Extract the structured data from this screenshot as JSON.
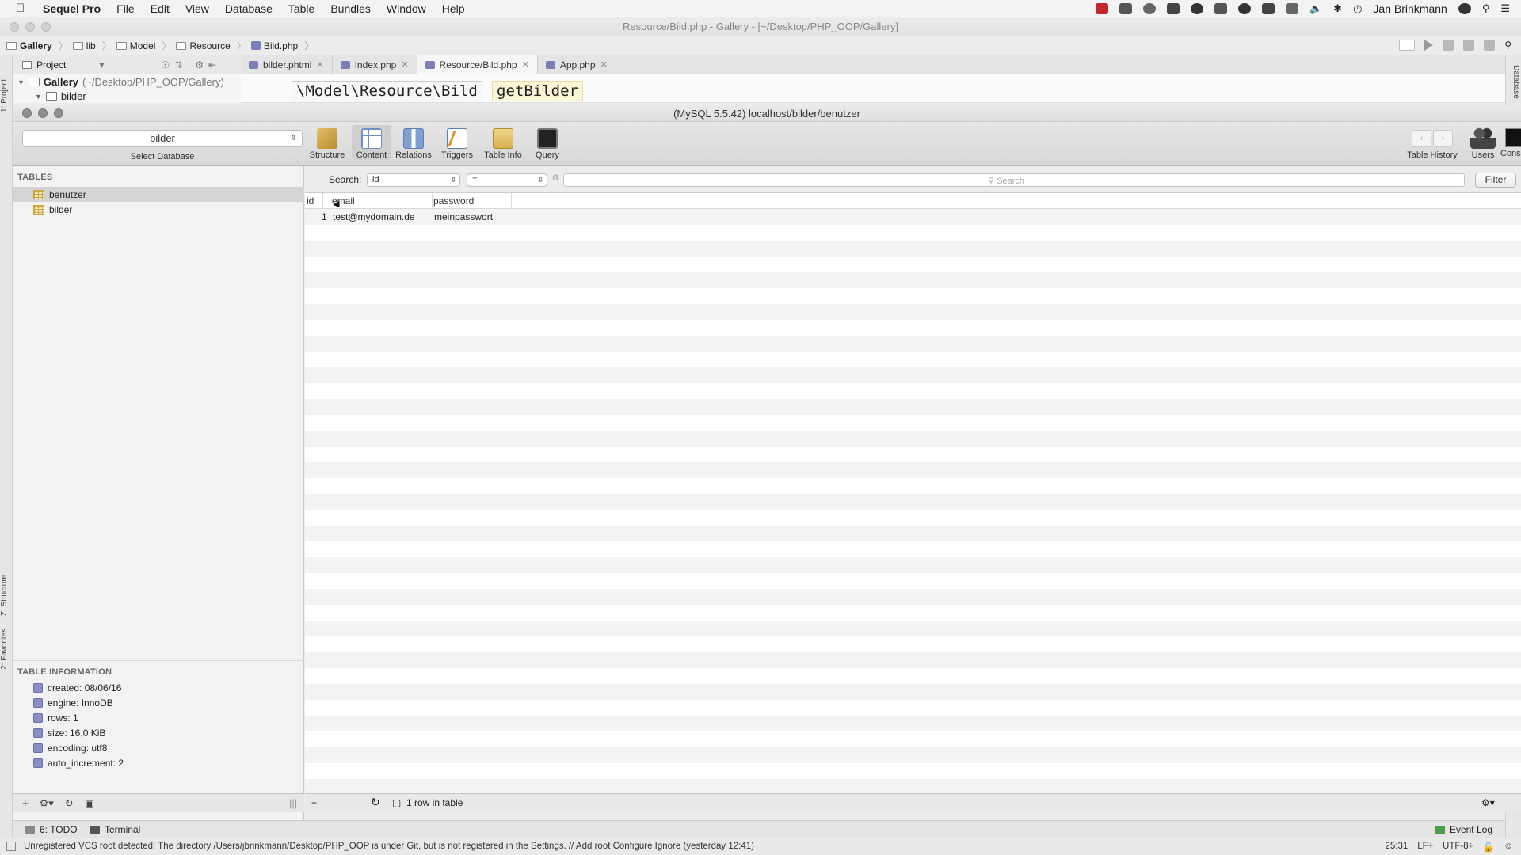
{
  "menubar": {
    "app_name": "Sequel Pro",
    "items": [
      "File",
      "Edit",
      "View",
      "Database",
      "Table",
      "Bundles",
      "Window",
      "Help"
    ],
    "user": "Jan Brinkmann"
  },
  "ide": {
    "window_title": "Resource/Bild.php - Gallery - [~/Desktop/PHP_OOP/Gallery]",
    "breadcrumb": [
      "Gallery",
      "lib",
      "Model",
      "Resource",
      "Bild.php"
    ],
    "project_selector": "Project",
    "tabs": [
      {
        "label": "bilder.phtml",
        "active": false
      },
      {
        "label": "Index.php",
        "active": false
      },
      {
        "label": "Resource/Bild.php",
        "active": true
      },
      {
        "label": "App.php",
        "active": false
      }
    ],
    "tree": {
      "root_name": "Gallery",
      "root_path": "(~/Desktop/PHP_OOP/Gallery)",
      "child": "bilder"
    },
    "code_namespace": "\\Model\\Resource\\Bild",
    "code_method": "getBilder",
    "side_labels": {
      "project": "1: Project",
      "structure": "Z: Structure",
      "favorites": "2: Favorites",
      "database": "Database"
    },
    "bottom_tabs": {
      "todo": "6: TODO",
      "terminal": "Terminal",
      "event_log": "Event Log"
    },
    "status_message": "Unregistered VCS root detected: The directory /Users/jbrinkmann/Desktop/PHP_OOP is under Git, but is not registered in the Settings. // Add root  Configure  Ignore (yesterday 12:41)",
    "status_right": {
      "position": "25:31",
      "line_sep": "LF÷",
      "encoding": "UTF-8÷"
    }
  },
  "sequel": {
    "window_title": "(MySQL 5.5.42) localhost/bilder/benutzer",
    "database": "bilder",
    "select_database_label": "Select Database",
    "toolbar": [
      {
        "key": "structure",
        "label": "Structure"
      },
      {
        "key": "content",
        "label": "Content"
      },
      {
        "key": "relations",
        "label": "Relations"
      },
      {
        "key": "triggers",
        "label": "Triggers"
      },
      {
        "key": "info",
        "label": "Table Info"
      },
      {
        "key": "query",
        "label": "Query"
      }
    ],
    "toolbar_right": {
      "history": "Table History",
      "users": "Users",
      "console": "Console"
    },
    "tables_header": "TABLES",
    "tables": [
      {
        "name": "benutzer",
        "selected": true
      },
      {
        "name": "bilder",
        "selected": false
      }
    ],
    "table_info_header": "TABLE INFORMATION",
    "table_info": [
      "created: 08/06/16",
      "engine: InnoDB",
      "rows: 1",
      "size: 16,0 KiB",
      "encoding: utf8",
      "auto_increment: 2"
    ],
    "filter": {
      "label": "Search:",
      "field": "id",
      "operator": "=",
      "placeholder": "Search",
      "button": "Filter"
    },
    "columns": [
      "id",
      "email",
      "password"
    ],
    "rows": [
      {
        "id": "1",
        "email": "test@mydomain.de",
        "password": "meinpasswort"
      }
    ],
    "row_count": "1 row in table"
  }
}
